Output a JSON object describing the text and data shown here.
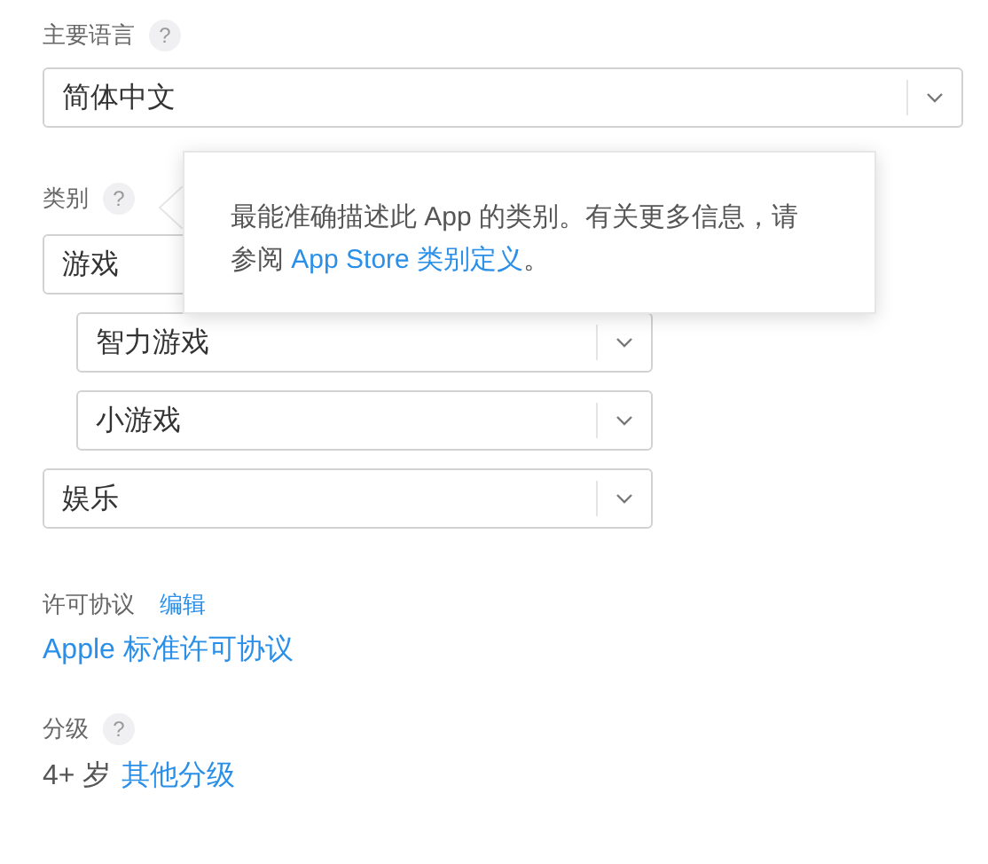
{
  "primary_language": {
    "label": "主要语言",
    "help": "?",
    "select": {
      "value": "简体中文"
    }
  },
  "category": {
    "label": "类别",
    "help": "?",
    "selects": [
      {
        "value": "游戏",
        "indented": false
      },
      {
        "value": "智力游戏",
        "indented": true
      },
      {
        "value": "小游戏",
        "indented": true
      },
      {
        "value": "娱乐",
        "indented": false
      }
    ],
    "tooltip": {
      "text_before": "最能准确描述此 App 的类别。有关更多信息，请参阅 ",
      "link": "App Store 类别定义",
      "text_after": "。"
    }
  },
  "license": {
    "label": "许可协议",
    "edit_link": "编辑",
    "agreement_link": "Apple 标准许可协议"
  },
  "rating": {
    "label": "分级",
    "help": "?",
    "value": "4+ 岁",
    "link": "其他分级"
  }
}
